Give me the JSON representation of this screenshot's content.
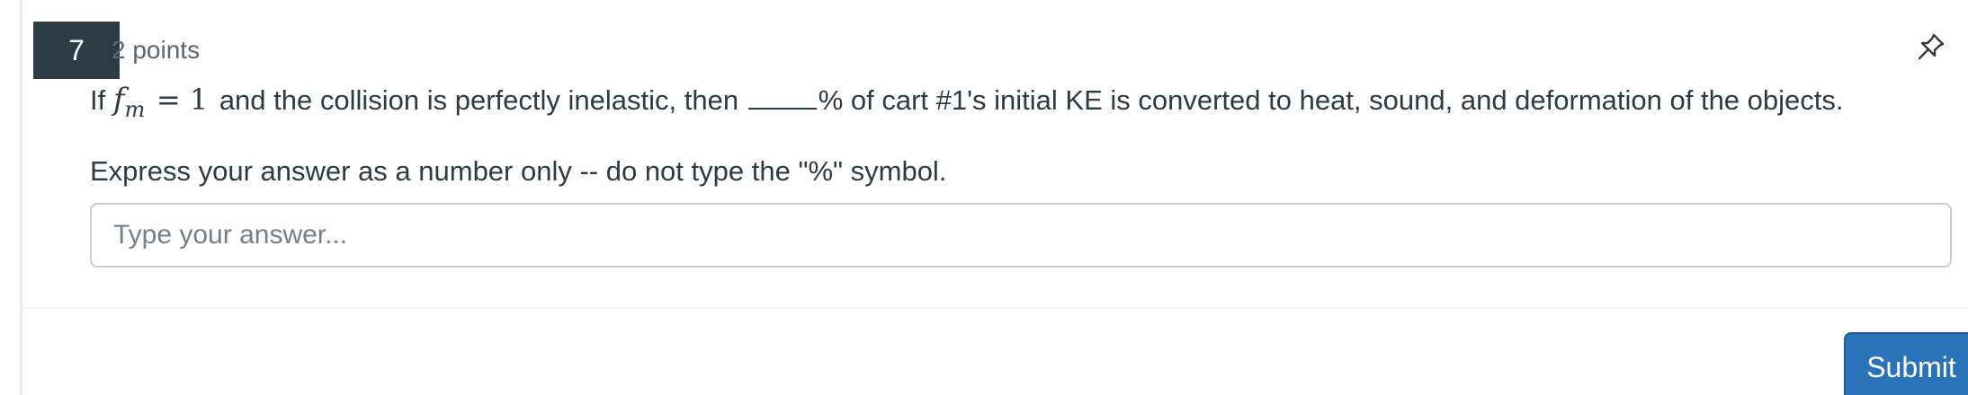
{
  "question": {
    "number": "7",
    "points": "2 points",
    "prompt": {
      "lead": "If",
      "math_var": "f",
      "math_sub": "m",
      "math_rest": "= 1",
      "after_math": "and the collision is perfectly inelastic, then",
      "after_blank": "% of cart #1's initial KE is converted to heat, sound, and deformation of the objects."
    },
    "instruction": "Express your answer as a number only -- do not type the \"%\" symbol.",
    "answer": {
      "value": "",
      "placeholder": "Type your answer..."
    }
  },
  "icons": {
    "pin": "pushpin-icon"
  },
  "actions": {
    "submit_label": "Submit"
  },
  "colors": {
    "number_badge_bg": "#2d3b45",
    "submit_bg": "#2b73b9",
    "text": "#2d3b45",
    "muted": "#5b6770"
  }
}
